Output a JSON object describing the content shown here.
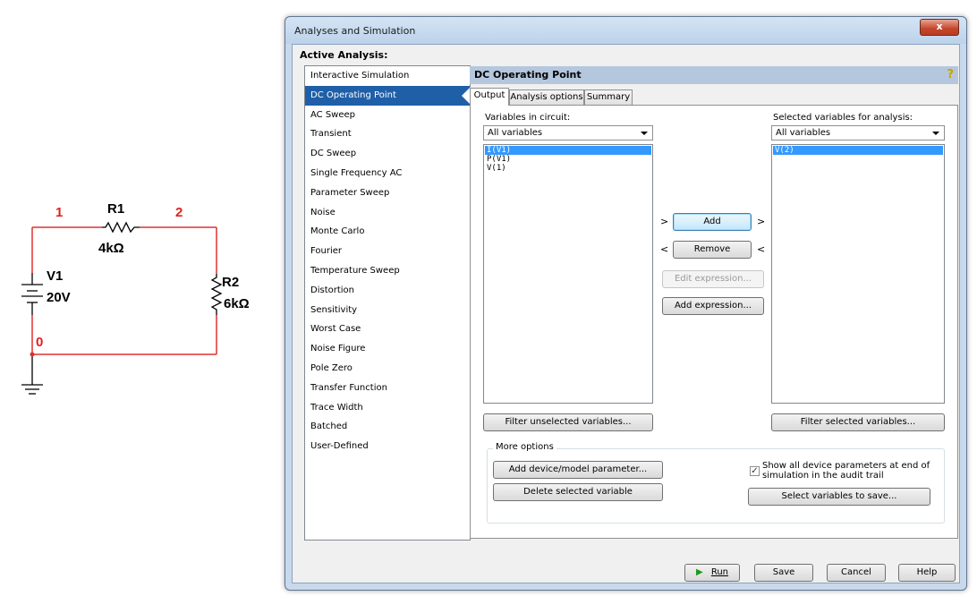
{
  "schematic": {
    "node_labels": [
      "1",
      "2",
      "0"
    ],
    "r1": {
      "name": "R1",
      "value": "4kΩ"
    },
    "r2": {
      "name": "R2",
      "value": "6kΩ"
    },
    "v1": {
      "name": "V1",
      "value": "20V"
    },
    "wire_color": "#e03030",
    "node_label_color": "#e02020"
  },
  "dialog": {
    "title": "Analyses and Simulation",
    "close_label": "x",
    "active_analysis_label": "Active Analysis:",
    "analyses": [
      "Interactive Simulation",
      "DC Operating Point",
      "AC Sweep",
      "Transient",
      "DC Sweep",
      "Single Frequency AC",
      "Parameter Sweep",
      "Noise",
      "Monte Carlo",
      "Fourier",
      "Temperature Sweep",
      "Distortion",
      "Sensitivity",
      "Worst Case",
      "Noise Figure",
      "Pole Zero",
      "Transfer Function",
      "Trace Width",
      "Batched",
      "User-Defined"
    ],
    "selected_analysis": "DC Operating Point",
    "header": {
      "title": "DC Operating Point",
      "help_icon": "?"
    },
    "tabs": [
      "Output",
      "Analysis options",
      "Summary"
    ],
    "active_tab": "Output",
    "output": {
      "variables_label": "Variables in circuit:",
      "variables_filter": "All variables",
      "variables": [
        "I(V1)",
        "P(V1)",
        "V(1)"
      ],
      "selected_in_circuit": "I(V1)",
      "selected_label": "Selected variables for analysis:",
      "selected_filter": "All variables",
      "selected_variables": [
        "V(2)"
      ],
      "add_label": "Add",
      "remove_label": "Remove",
      "edit_expression_label": "Edit expression...",
      "add_expression_label": "Add expression...",
      "filter_unselected_label": "Filter unselected variables...",
      "filter_selected_label": "Filter selected variables...",
      "chevron_right": ">",
      "chevron_left": "<"
    },
    "more_options": {
      "legend": "More options",
      "add_device_label": "Add device/model parameter...",
      "delete_variable_label": "Delete selected variable",
      "show_all_checked": true,
      "show_all_label_line1": "Show all device parameters at end of",
      "show_all_label_line2": "simulation in the audit trail",
      "select_to_save_label": "Select variables to save..."
    },
    "footer": {
      "run_label": "Run",
      "save_label": "Save",
      "cancel_label": "Cancel",
      "help_label": "Help"
    }
  }
}
